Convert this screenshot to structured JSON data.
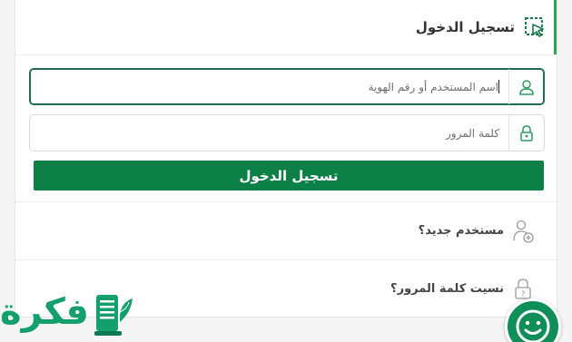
{
  "header": {
    "title": "تسجيل الدخول",
    "icon": "cursor-select-icon"
  },
  "username": {
    "placeholder": "اسم المستخدم أو رقم الهوية",
    "icon": "user-icon"
  },
  "password": {
    "placeholder": "كلمة المرور",
    "icon": "lock-icon"
  },
  "login_button": {
    "label": "تسجيل الدخول"
  },
  "links": [
    {
      "label": "مستخدم جديد؟",
      "icon": "add-user-icon"
    },
    {
      "label": "نسيت كلمة المرور؟",
      "icon": "lock-question-icon"
    }
  ],
  "logo": {
    "text": "فكرة"
  },
  "colors": {
    "accent": "#0c8046",
    "focus": "#1e6b52",
    "brand": "#14a06c"
  }
}
